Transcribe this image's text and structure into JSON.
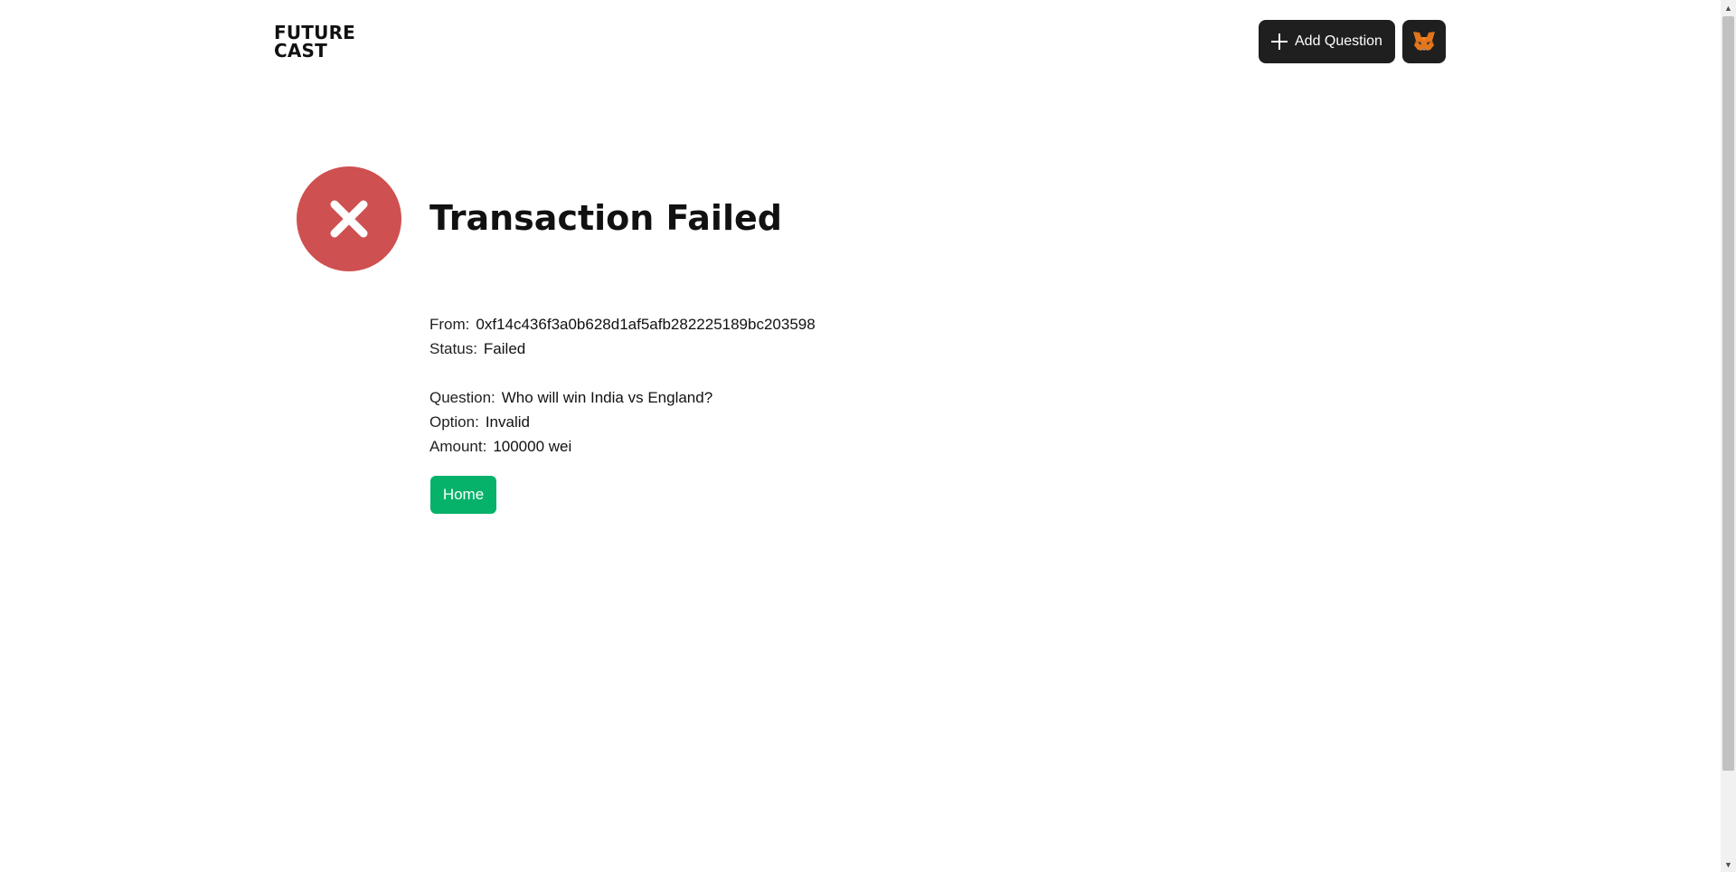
{
  "header": {
    "logo_line1": "FUTURE",
    "logo_line2": "CAST",
    "add_question_label": "Add Question",
    "wallet_icon": "metamask-fox-icon"
  },
  "main": {
    "title": "Transaction Failed",
    "status_icon": "x-circle-icon",
    "from_label": "From:",
    "from_value": "0xf14c436f3a0b628d1af5afb282225189bc203598",
    "status_label": "Status:",
    "status_value": "Failed",
    "question_label": "Question:",
    "question_value": "Who will win India vs England?",
    "option_label": "Option:",
    "option_value": "Invalid",
    "amount_label": "Amount:",
    "amount_value": "100000 wei",
    "home_label": "Home"
  },
  "colors": {
    "error": "#cf5050",
    "primary_dark": "#1f1f1f",
    "success": "#06b26a"
  }
}
